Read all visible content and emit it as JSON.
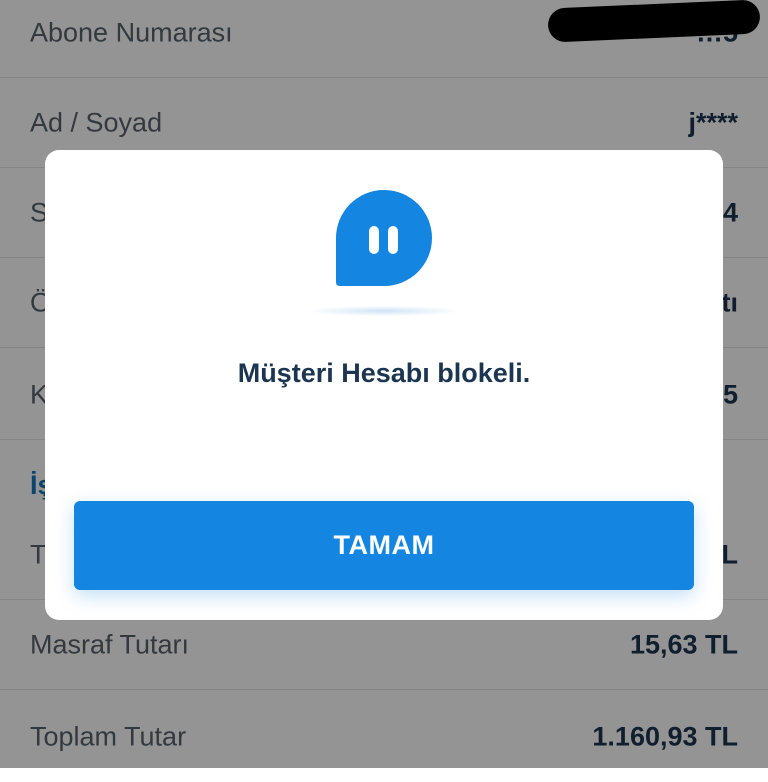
{
  "details": {
    "rows": [
      {
        "label": "Abone Numarası",
        "value": "…5"
      },
      {
        "label": "Ad / Soyad",
        "value": "j****"
      },
      {
        "label": "S",
        "value": "4"
      },
      {
        "label": "Ö",
        "value": "tı"
      },
      {
        "label": "K",
        "value": "5"
      }
    ],
    "section_title": "İş",
    "row_t": {
      "label": "T",
      "value": "L"
    },
    "masraf": {
      "label": "Masraf Tutarı",
      "value": "15,63 TL"
    },
    "toplam": {
      "label": "Toplam Tutar",
      "value": "1.160,93 TL"
    }
  },
  "dialog": {
    "icon": "pause-icon",
    "message": "Müşteri Hesabı blokeli.",
    "ok_label": "TAMAM"
  },
  "colors": {
    "accent": "#1485e0",
    "text_dark": "#1c3550",
    "label_gray": "#58626c",
    "overlay": "rgba(0,0,0,0.42)"
  }
}
